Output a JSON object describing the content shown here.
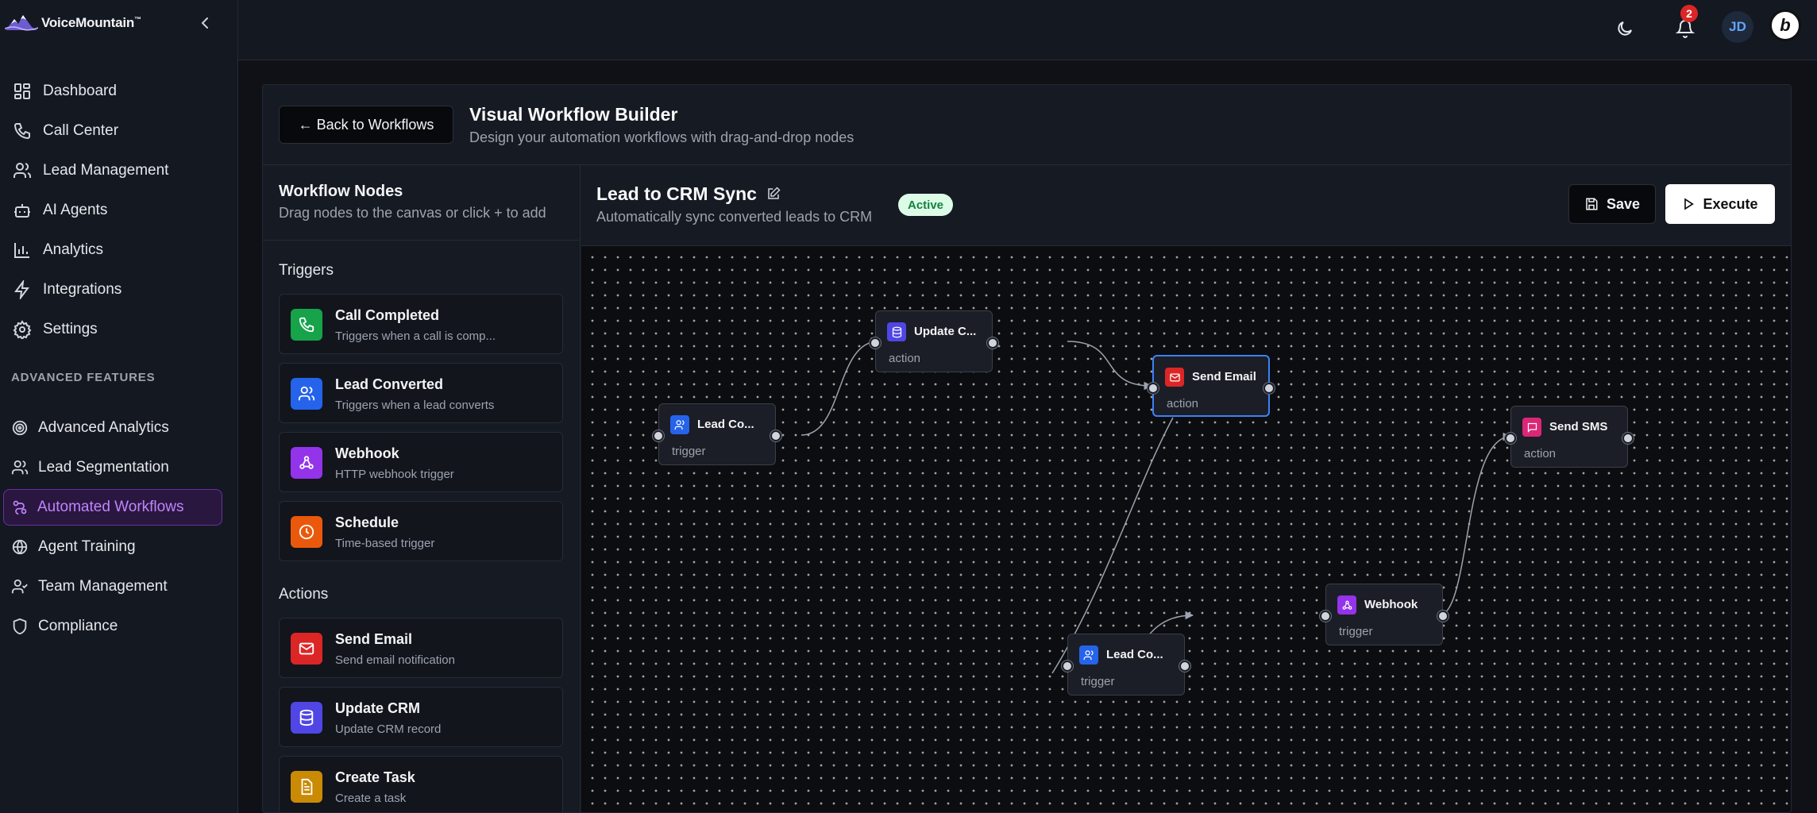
{
  "brand": {
    "name": "VoiceMountain",
    "tm": "™"
  },
  "nav": [
    {
      "label": "Dashboard",
      "icon": "dashboard-icon"
    },
    {
      "label": "Call Center",
      "icon": "phone-icon"
    },
    {
      "label": "Lead Management",
      "icon": "users-icon"
    },
    {
      "label": "AI Agents",
      "icon": "bot-icon"
    },
    {
      "label": "Analytics",
      "icon": "bar-chart-icon"
    },
    {
      "label": "Integrations",
      "icon": "bolt-icon"
    },
    {
      "label": "Settings",
      "icon": "gear-icon"
    }
  ],
  "advanced_label": "ADVANCED FEATURES",
  "advanced_nav": [
    {
      "label": "Advanced Analytics",
      "icon": "target-icon"
    },
    {
      "label": "Lead Segmentation",
      "icon": "users-icon"
    },
    {
      "label": "Automated Workflows",
      "icon": "workflow-icon",
      "active": true
    },
    {
      "label": "Agent Training",
      "icon": "globe-icon"
    },
    {
      "label": "Team Management",
      "icon": "user-check-icon"
    },
    {
      "label": "Compliance",
      "icon": "shield-icon"
    }
  ],
  "header": {
    "notifications": "2",
    "avatar": "JD",
    "user_logo": "b"
  },
  "page": {
    "back": "← Back to Workflows",
    "title": "Visual Workflow Builder",
    "subtitle": "Design your automation workflows with drag-and-drop nodes"
  },
  "panel": {
    "title": "Workflow Nodes",
    "subtitle": "Drag nodes to the canvas or click + to add",
    "triggers_label": "Triggers",
    "actions_label": "Actions",
    "triggers": [
      {
        "title": "Call Completed",
        "desc": "Triggers when a call is comp...",
        "color": "#16a34a",
        "icon": "phone-icon"
      },
      {
        "title": "Lead Converted",
        "desc": "Triggers when a lead converts",
        "color": "#2563eb",
        "icon": "users-icon"
      },
      {
        "title": "Webhook",
        "desc": "HTTP webhook trigger",
        "color": "#9333ea",
        "icon": "webhook-icon"
      },
      {
        "title": "Schedule",
        "desc": "Time-based trigger",
        "color": "#ea580c",
        "icon": "clock-icon"
      }
    ],
    "actions": [
      {
        "title": "Send Email",
        "desc": "Send email notification",
        "color": "#dc2626",
        "icon": "mail-icon"
      },
      {
        "title": "Update CRM",
        "desc": "Update CRM record",
        "color": "#4f46e5",
        "icon": "database-icon"
      },
      {
        "title": "Create Task",
        "desc": "Create a task",
        "color": "#ca8a04",
        "icon": "file-icon"
      }
    ]
  },
  "workflow": {
    "name": "Lead to CRM Sync",
    "description": "Automatically sync converted leads to CRM",
    "status": "Active",
    "save": "Save",
    "execute": "Execute"
  },
  "canvas_nodes": [
    {
      "label": "Lead Co...",
      "type": "trigger",
      "color": "#2563eb",
      "icon": "users-icon"
    },
    {
      "label": "Update C...",
      "type": "action",
      "color": "#4f46e5",
      "icon": "database-icon"
    },
    {
      "label": "Send Email",
      "type": "action",
      "color": "#dc2626",
      "icon": "mail-icon",
      "selected": true
    },
    {
      "label": "Send SMS",
      "type": "action",
      "color": "#db2777",
      "icon": "message-icon"
    },
    {
      "label": "Webhook",
      "type": "trigger",
      "color": "#9333ea",
      "icon": "webhook-icon"
    },
    {
      "label": "Lead Co...",
      "type": "trigger",
      "color": "#2563eb",
      "icon": "users-icon"
    }
  ]
}
